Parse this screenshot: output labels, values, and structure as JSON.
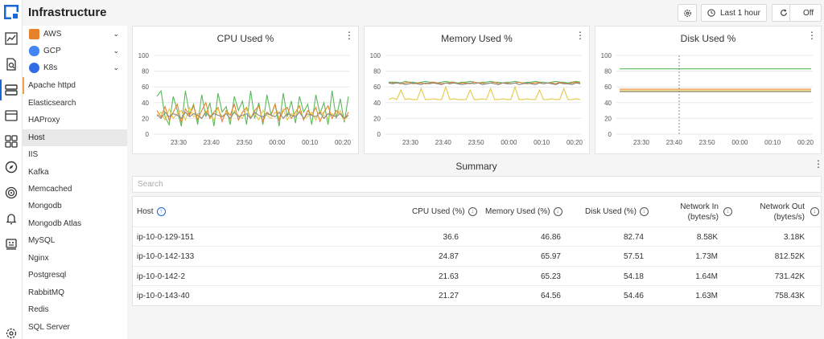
{
  "app": {
    "title": "Infrastructure"
  },
  "toolbar": {
    "time_range": "Last 1 hour",
    "refresh_label": "Off"
  },
  "rail_icons": [
    "logo-icon",
    "metrics-icon",
    "log-search-icon",
    "infrastructure-icon",
    "browser-icon",
    "dashboards-icon",
    "explore-icon",
    "target-icon",
    "alerts-icon",
    "robot-icon",
    "settings-icon"
  ],
  "sidebar": {
    "clouds": [
      {
        "label": "AWS",
        "color": "#e8822a"
      },
      {
        "label": "GCP",
        "color": "#4285f4"
      },
      {
        "label": "K8s",
        "color": "#326ce5"
      }
    ],
    "items": [
      "Apache httpd",
      "Elasticsearch",
      "HAProxy",
      "Host",
      "IIS",
      "Kafka",
      "Memcached",
      "Mongodb",
      "Mongodb Atlas",
      "MySQL",
      "Nginx",
      "Postgresql",
      "RabbitMQ",
      "Redis",
      "SQL Server"
    ],
    "selected": "Host"
  },
  "chart_data": [
    {
      "type": "line",
      "title": "CPU Used %",
      "x_ticks": [
        "23:30",
        "23:40",
        "23:50",
        "00:00",
        "00:10",
        "00:20"
      ],
      "ylim": [
        0,
        100
      ],
      "y_ticks": [
        "0",
        "20",
        "40",
        "60",
        "80",
        "100"
      ],
      "series": [
        {
          "color": "#5cb85c",
          "values": [
            48,
            55,
            22,
            12,
            48,
            30,
            10,
            55,
            25,
            38,
            12,
            50,
            22,
            40,
            10,
            52,
            28,
            35,
            12,
            48,
            30,
            42,
            12,
            55,
            20,
            40,
            12,
            50,
            25,
            38,
            10,
            52,
            22,
            42,
            14,
            48,
            28,
            38,
            12,
            50,
            26,
            40,
            12,
            55,
            20,
            45,
            15,
            48
          ]
        },
        {
          "color": "#e8822a",
          "values": [
            30,
            22,
            35,
            18,
            28,
            38,
            15,
            32,
            24,
            36,
            18,
            30,
            40,
            20,
            28,
            34,
            16,
            30,
            24,
            38,
            18,
            28,
            34,
            20,
            30,
            36,
            16,
            28,
            24,
            38,
            18,
            30,
            34,
            20,
            28,
            36,
            18,
            30,
            24,
            34,
            16,
            28,
            36,
            20,
            30,
            26,
            18,
            28
          ]
        },
        {
          "color": "#e5c94a",
          "values": [
            22,
            28,
            18,
            32,
            20,
            26,
            30,
            18,
            34,
            22,
            26,
            20,
            30,
            24,
            18,
            32,
            22,
            28,
            18,
            30,
            24,
            20,
            32,
            22,
            26,
            18,
            30,
            24,
            20,
            28,
            22,
            32,
            18,
            26,
            24,
            30,
            20,
            22,
            28,
            18,
            30,
            24,
            20,
            26,
            22,
            30,
            18,
            24
          ]
        },
        {
          "color": "#888888",
          "values": [
            25,
            20,
            28,
            22,
            26,
            24,
            20,
            28,
            22,
            26,
            24,
            20,
            28,
            22,
            26,
            24,
            22,
            26,
            20,
            28,
            22,
            24,
            26,
            20,
            28,
            24,
            22,
            26,
            24,
            22,
            28,
            20,
            26,
            24,
            22,
            28,
            20,
            26,
            24,
            22,
            28,
            20,
            26,
            24,
            22,
            26,
            20,
            24
          ]
        }
      ]
    },
    {
      "type": "line",
      "title": "Memory Used %",
      "x_ticks": [
        "23:30",
        "23:40",
        "23:50",
        "00:00",
        "00:10",
        "00:20"
      ],
      "ylim": [
        0,
        100
      ],
      "y_ticks": [
        "0",
        "20",
        "40",
        "60",
        "80",
        "100"
      ],
      "series": [
        {
          "color": "#5cb85c",
          "values": [
            66,
            66,
            66,
            65,
            67,
            66,
            66,
            65,
            66,
            67,
            66,
            66,
            65,
            66,
            67,
            66,
            66,
            65,
            66,
            66,
            67,
            66,
            65,
            66,
            66,
            67,
            66,
            66,
            65,
            66,
            66,
            67,
            66,
            65,
            66,
            66,
            67,
            66,
            66,
            65,
            66,
            67,
            66,
            66,
            65,
            66,
            67,
            66
          ]
        },
        {
          "color": "#e8822a",
          "values": [
            65,
            65,
            65,
            64,
            65,
            66,
            64,
            65,
            65,
            64,
            65,
            66,
            65,
            64,
            65,
            65,
            66,
            64,
            65,
            65,
            64,
            66,
            65,
            65,
            64,
            65,
            66,
            64,
            65,
            65,
            64,
            65,
            66,
            65,
            64,
            65,
            65,
            66,
            64,
            65,
            65,
            64,
            66,
            65,
            64,
            65,
            66,
            65
          ]
        },
        {
          "color": "#888888",
          "values": [
            65,
            64,
            65,
            65,
            63,
            64,
            65,
            64,
            63,
            65,
            64,
            65,
            64,
            63,
            65,
            64,
            65,
            64,
            63,
            64,
            65,
            64,
            65,
            63,
            64,
            65,
            64,
            63,
            65,
            64,
            64,
            65,
            63,
            64,
            65,
            64,
            63,
            65,
            64,
            65,
            64,
            63,
            65,
            64,
            64,
            63,
            65,
            64
          ]
        },
        {
          "color": "#e5c94a",
          "values": [
            44,
            46,
            44,
            56,
            44,
            45,
            44,
            44,
            58,
            44,
            44,
            45,
            44,
            44,
            60,
            44,
            45,
            44,
            44,
            44,
            56,
            44,
            44,
            45,
            44,
            58,
            44,
            44,
            45,
            44,
            44,
            60,
            44,
            44,
            45,
            44,
            44,
            56,
            44,
            44,
            45,
            44,
            44,
            58,
            44,
            44,
            45,
            44
          ]
        }
      ]
    },
    {
      "type": "line",
      "title": "Disk Used %",
      "x_ticks": [
        "23:30",
        "23:40",
        "23:50",
        "00:00",
        "00:10",
        "00:20"
      ],
      "ylim": [
        0,
        100
      ],
      "y_ticks": [
        "0",
        "20",
        "40",
        "60",
        "80",
        "100"
      ],
      "series": [
        {
          "color": "#5cb85c",
          "values": [
            83,
            83,
            83,
            83,
            83,
            83,
            83,
            83,
            83,
            83,
            83,
            83,
            83,
            83,
            83,
            83,
            83,
            83,
            83,
            83,
            83,
            83,
            83,
            83,
            83,
            83,
            83,
            83,
            83,
            83,
            83,
            83,
            83,
            83,
            83,
            83,
            83,
            83,
            83,
            83,
            83,
            83,
            83,
            83,
            83,
            83,
            83,
            83
          ]
        },
        {
          "color": "#e8822a",
          "values": [
            57,
            57,
            57,
            57,
            57,
            57,
            57,
            57,
            57,
            57,
            57,
            57,
            57,
            57,
            57,
            57,
            57,
            57,
            57,
            57,
            57,
            57,
            57,
            57,
            57,
            57,
            57,
            57,
            57,
            57,
            57,
            57,
            57,
            57,
            57,
            57,
            57,
            57,
            57,
            57,
            57,
            57,
            57,
            57,
            57,
            57,
            57,
            57
          ]
        },
        {
          "color": "#e5c94a",
          "values": [
            55,
            55,
            55,
            55,
            55,
            55,
            55,
            55,
            55,
            55,
            55,
            55,
            55,
            55,
            55,
            55,
            55,
            55,
            55,
            55,
            55,
            55,
            55,
            55,
            55,
            55,
            55,
            55,
            55,
            55,
            55,
            55,
            55,
            55,
            55,
            55,
            55,
            55,
            55,
            55,
            55,
            55,
            55,
            55,
            55,
            55,
            55,
            55
          ]
        },
        {
          "color": "#888888",
          "values": [
            54,
            54,
            54,
            54,
            54,
            54,
            54,
            54,
            54,
            54,
            54,
            54,
            54,
            54,
            54,
            54,
            54,
            54,
            54,
            54,
            54,
            54,
            54,
            54,
            54,
            54,
            54,
            54,
            54,
            54,
            54,
            54,
            54,
            54,
            54,
            54,
            54,
            54,
            54,
            54,
            54,
            54,
            54,
            54,
            54,
            54,
            54,
            54
          ]
        }
      ]
    }
  ],
  "summary": {
    "title": "Summary",
    "search_placeholder": "Search",
    "columns": {
      "host": "Host",
      "cpu": "CPU Used (%)",
      "memory": "Memory Used (%)",
      "disk": "Disk Used (%)",
      "net_in_1": "Network In",
      "net_in_2": "(bytes/s)",
      "net_out_1": "Network Out",
      "net_out_2": "(bytes/s)"
    },
    "rows": [
      {
        "host": "ip-10-0-129-151",
        "cpu": "36.6",
        "memory": "46.86",
        "disk": "82.74",
        "net_in": "8.58K",
        "net_out": "3.18K"
      },
      {
        "host": "ip-10-0-142-133",
        "cpu": "24.87",
        "memory": "65.97",
        "disk": "57.51",
        "net_in": "1.73M",
        "net_out": "812.52K"
      },
      {
        "host": "ip-10-0-142-2",
        "cpu": "21.63",
        "memory": "65.23",
        "disk": "54.18",
        "net_in": "1.64M",
        "net_out": "731.42K"
      },
      {
        "host": "ip-10-0-143-40",
        "cpu": "21.27",
        "memory": "64.56",
        "disk": "54.46",
        "net_in": "1.63M",
        "net_out": "758.43K"
      }
    ]
  }
}
